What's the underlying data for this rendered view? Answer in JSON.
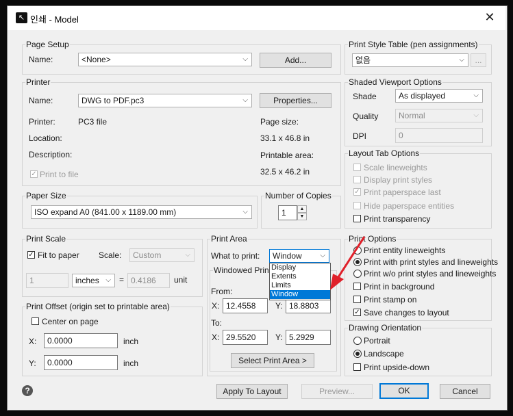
{
  "window": {
    "title": "인쇄 - Model",
    "app_icon_glyph": "↖",
    "close_glyph": "✕"
  },
  "page_setup": {
    "group": "Page Setup",
    "name_label": "Name:",
    "name_value": "<None>",
    "add_button": "Add..."
  },
  "printer": {
    "group": "Printer",
    "name_label": "Name:",
    "name_value": "DWG to PDF.pc3",
    "properties_button": "Properties...",
    "printer_label": "Printer:",
    "printer_value": "PC3 file",
    "location_label": "Location:",
    "description_label": "Description:",
    "print_to_file": "Print to file",
    "page_size_label": "Page size:",
    "page_size_value": "33.1 x 46.8 in",
    "printable_label": "Printable area:",
    "printable_value": "32.5 x 46.2 in"
  },
  "paper_size": {
    "group": "Paper Size",
    "value": "ISO expand A0 (841.00 x 1189.00 mm)"
  },
  "copies": {
    "group": "Number of Copies",
    "value": "1",
    "up": "▲",
    "down": "▼"
  },
  "print_scale": {
    "group": "Print Scale",
    "fit_to_paper": "Fit to paper",
    "scale_label": "Scale:",
    "scale_value": "Custom",
    "value1": "1",
    "unit_value": "inches",
    "equals": "=",
    "value2": "0.4186",
    "unit_label": "unit"
  },
  "print_offset": {
    "group": "Print Offset (origin set to printable area)",
    "center_on_page": "Center on page",
    "x_label": "X:",
    "x_value": "0.0000",
    "y_label": "Y:",
    "y_value": "0.0000",
    "unit1": "inch",
    "unit2": "inch"
  },
  "print_area": {
    "group": "Print Area",
    "what_label": "What to print:",
    "what_value": "Window",
    "options": [
      "Display",
      "Extents",
      "Limits",
      "Window"
    ],
    "windowed_group": "Windowed Print A",
    "from_label": "From:",
    "from_x_label": "X:",
    "from_x": "12.4558",
    "from_y_label": "Y:",
    "from_y": "18.8803",
    "to_label": "To:",
    "to_x_label": "X:",
    "to_x": "29.5520",
    "to_y_label": "Y:",
    "to_y": "5.2929",
    "select_button": "Select Print Area >"
  },
  "print_style_table": {
    "group": "Print Style Table (pen assignments)",
    "value": "없음",
    "ellipsis_button": "..."
  },
  "shaded_viewport": {
    "group": "Shaded Viewport Options",
    "shade_label": "Shade",
    "shade_value": "As displayed",
    "quality_label": "Quality",
    "quality_value": "Normal",
    "dpi_label": "DPI",
    "dpi_value": "0"
  },
  "layout_tab": {
    "group": "Layout Tab Options",
    "scale_lineweights": "Scale lineweights",
    "display_print_styles": "Display print styles",
    "print_paperspace_last": "Print paperspace last",
    "hide_paperspace": "Hide paperspace entities",
    "print_transparency": "Print transparency"
  },
  "print_options": {
    "group": "Print Options",
    "entity_lineweights": "Print entity lineweights",
    "with_print_styles": "Print with print styles and lineweights",
    "wo_print_styles": "Print w/o print styles and lineweights",
    "print_in_background": "Print in background",
    "print_stamp_on": "Print stamp on",
    "save_changes": "Save changes to layout"
  },
  "drawing_orientation": {
    "group": "Drawing Orientation",
    "portrait": "Portrait",
    "landscape": "Landscape",
    "upside_down": "Print upside-down"
  },
  "footer": {
    "help_glyph": "?",
    "apply_button": "Apply To Layout",
    "preview_button": "Preview...",
    "ok_button": "OK",
    "cancel_button": "Cancel"
  },
  "glyphs": {
    "check": "✓",
    "chevron": "⌵"
  },
  "colors": {
    "accent": "#0078d7",
    "arrow": "#e0202a"
  }
}
